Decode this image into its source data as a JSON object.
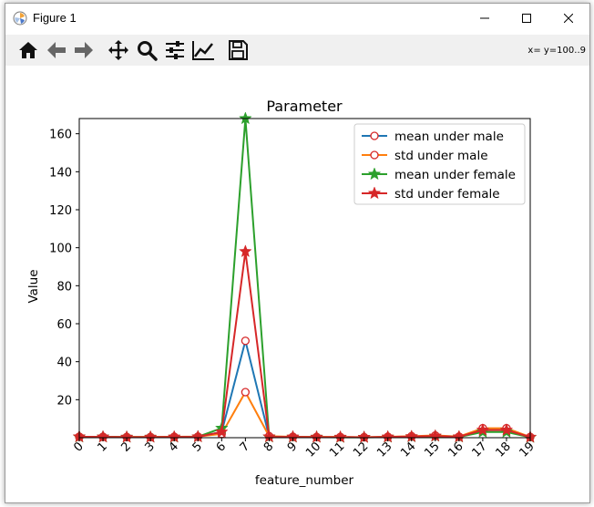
{
  "window": {
    "title": "Figure 1"
  },
  "toolbar": {
    "buttons": [
      {
        "name": "home-button",
        "icon": "home-icon"
      },
      {
        "name": "back-button",
        "icon": "arrow-left-icon"
      },
      {
        "name": "forward-button",
        "icon": "arrow-right-icon"
      },
      {
        "name": "pan-button",
        "icon": "move-icon"
      },
      {
        "name": "zoom-button",
        "icon": "magnifier-icon"
      },
      {
        "name": "configure-subplots-button",
        "icon": "sliders-icon"
      },
      {
        "name": "edit-axis-button",
        "icon": "line-chart-icon"
      },
      {
        "name": "save-button",
        "icon": "floppy-disk-icon"
      }
    ],
    "coords": "x=  y=100..9"
  },
  "colors": {
    "blue": "#1f77b4",
    "orange": "#ff7f0e",
    "green": "#2ca02c",
    "red": "#d62728"
  },
  "chart_data": {
    "type": "line",
    "title": "Parameter",
    "xlabel": "feature_number",
    "ylabel": "Value",
    "x": [
      0,
      1,
      2,
      3,
      4,
      5,
      6,
      7,
      8,
      9,
      10,
      11,
      12,
      13,
      14,
      15,
      16,
      17,
      18,
      19
    ],
    "xlim": [
      0,
      19
    ],
    "ylim": [
      0,
      168
    ],
    "yticks": [
      20,
      40,
      60,
      80,
      100,
      120,
      140,
      160
    ],
    "xtick_labels": [
      "0",
      "1",
      "2",
      "3",
      "4",
      "5",
      "6",
      "7",
      "8",
      "9",
      "10",
      "11",
      "12",
      "13",
      "14",
      "15",
      "16",
      "17",
      "18",
      "19"
    ],
    "ytick_labels": [
      "20",
      "40",
      "60",
      "80",
      "100",
      "120",
      "140",
      "160"
    ],
    "legend_position": "top-right",
    "grid": false,
    "series": [
      {
        "name": "mean under male",
        "color": "#1f77b4",
        "marker": "circle-open",
        "values": [
          0.5,
          0.4,
          0.3,
          0.3,
          0.4,
          0.5,
          3,
          51,
          0.6,
          0.4,
          0.3,
          0.3,
          0.2,
          0.4,
          0.6,
          0.9,
          0.5,
          4,
          4,
          0.3
        ]
      },
      {
        "name": "std under male",
        "color": "#ff7f0e",
        "marker": "circle-open",
        "values": [
          0.5,
          0.5,
          0.4,
          0.4,
          0.5,
          0.6,
          2,
          24,
          0.8,
          0.5,
          0.4,
          0.4,
          0.3,
          0.5,
          0.8,
          1.2,
          0.6,
          5,
          5,
          0.4
        ]
      },
      {
        "name": "mean under female",
        "color": "#2ca02c",
        "marker": "star",
        "values": [
          0.4,
          0.4,
          0.3,
          0.3,
          0.3,
          0.5,
          5,
          168,
          0.4,
          0.3,
          0.3,
          0.2,
          0.2,
          0.3,
          0.5,
          0.8,
          0.4,
          3,
          3,
          0.2
        ]
      },
      {
        "name": "std under female",
        "color": "#d62728",
        "marker": "star",
        "values": [
          0.5,
          0.4,
          0.3,
          0.3,
          0.4,
          0.5,
          3,
          98,
          0.5,
          0.4,
          0.3,
          0.3,
          0.2,
          0.4,
          0.6,
          0.9,
          0.5,
          4,
          4,
          0.3
        ]
      }
    ]
  }
}
